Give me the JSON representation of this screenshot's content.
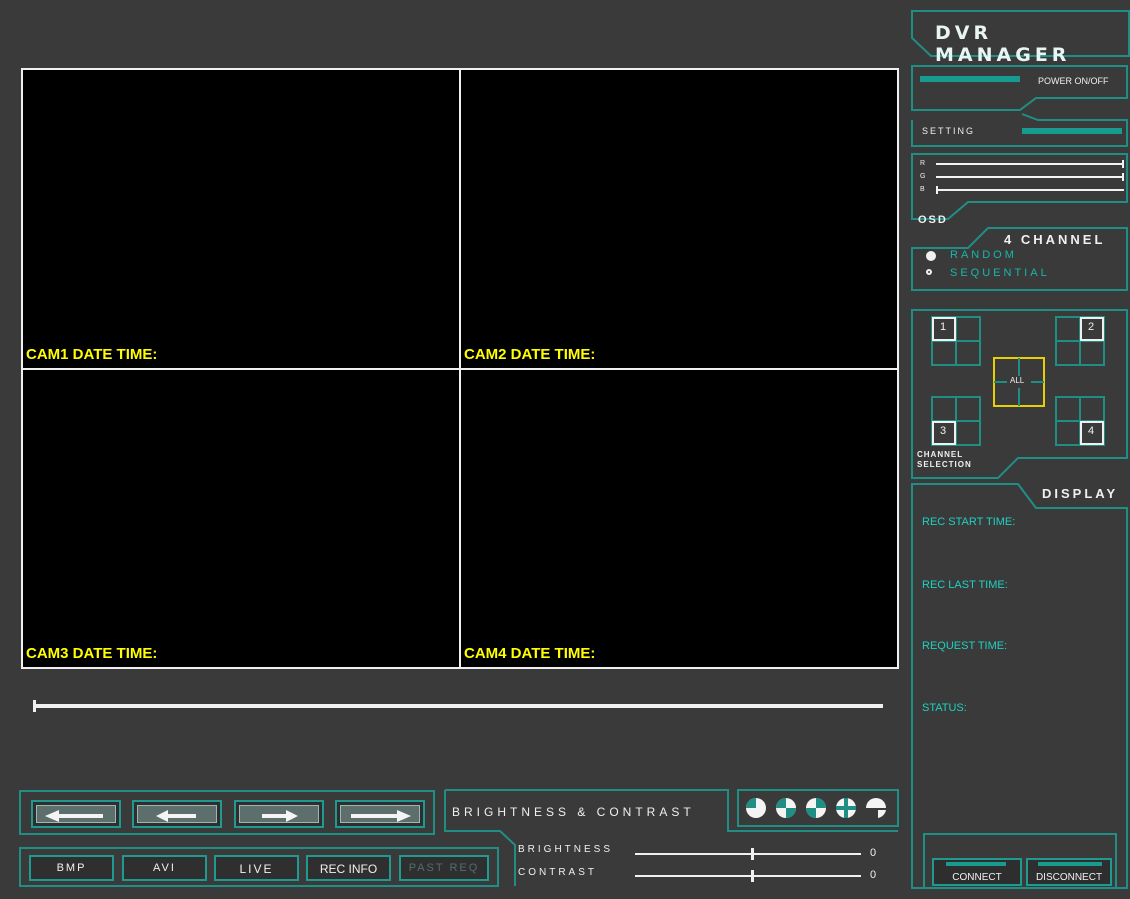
{
  "header": {
    "title": "DVR MANAGER"
  },
  "cameras": [
    {
      "label": "CAM1 DATE TIME:"
    },
    {
      "label": "CAM2 DATE TIME:"
    },
    {
      "label": "CAM3 DATE TIME:"
    },
    {
      "label": "CAM4 DATE TIME:"
    }
  ],
  "power": {
    "label": "POWER ON/OFF"
  },
  "setting": {
    "label": "SETTING"
  },
  "osd": {
    "label": "OSD",
    "channels": [
      "R",
      "G",
      "B"
    ],
    "levels": [
      1.0,
      1.0,
      0.0
    ]
  },
  "channel_mode": {
    "title": "4 CHANNEL",
    "options": [
      "RANDOM",
      "SEQUENTIAL"
    ],
    "selected": "SEQUENTIAL"
  },
  "channel_selection": {
    "title_line1": "CHANNEL",
    "title_line2": "SELECTION",
    "channels": [
      "1",
      "2",
      "3",
      "4"
    ],
    "all_label": "ALL"
  },
  "display": {
    "title": "DISPLAY",
    "fields": [
      "REC START TIME:",
      "REC LAST TIME:",
      "REQUEST TIME:",
      "STATUS:"
    ]
  },
  "connection": {
    "connect_label": "CONNECT",
    "disconnect_label": "DISCONNECT"
  },
  "bottom": {
    "buttons": [
      "BMP",
      "AVI",
      "LIVE",
      "REC INFO",
      "PAST REQ"
    ],
    "brightness_contrast_label": "BRIGHTNESS & CONTRAST",
    "brightness_label": "BRIGHTNESS",
    "contrast_label": "CONTRAST",
    "brightness_value": "0",
    "contrast_value": "0",
    "brightness_level": 0.52,
    "contrast_level": 0.52
  },
  "playback": {
    "position": 0.0
  },
  "colors": {
    "accent": "#1f8f86",
    "cam_text": "#ffff00",
    "highlight": "#e8d000"
  }
}
